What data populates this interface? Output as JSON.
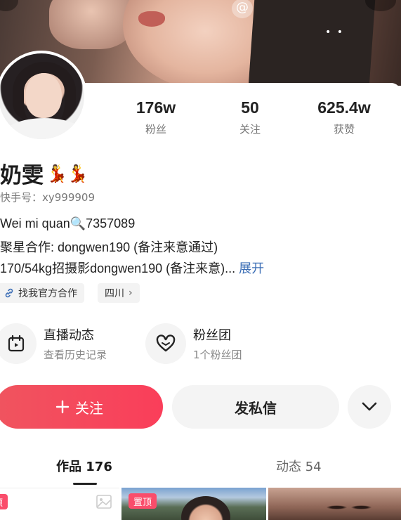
{
  "profile": {
    "name": "奶雯",
    "name_emoji": "💃💃",
    "kuaishou_id": "快手号：xy999909",
    "stats": [
      {
        "value": "176w",
        "label": "粉丝"
      },
      {
        "value": "50",
        "label": "关注"
      },
      {
        "value": "625.4w",
        "label": "获赞"
      }
    ],
    "bio_lines": [
      "Wei mi quan🔍7357089",
      "聚星合作: dongwen190 (备注来意通过)",
      "170/54kg招摄影dongwen190 (备注来意)..."
    ],
    "bio_more": "展开",
    "chips": {
      "official": "找我官方合作",
      "region": "四川"
    }
  },
  "features": [
    {
      "title": "直播动态",
      "subtitle": "查看历史记录",
      "icon": "calendar-icon"
    },
    {
      "title": "粉丝团",
      "subtitle": "1个粉丝团",
      "icon": "heart-outline-icon"
    }
  ],
  "actions": {
    "follow_label": "关注",
    "message_label": "发私信"
  },
  "tabs": [
    {
      "label": "作品 176"
    },
    {
      "label": "动态 54"
    }
  ],
  "thumbnails": {
    "pin_label": "置顶",
    "pin_label_partial": "顶"
  },
  "colors": {
    "accent": "#FA3E5A",
    "link": "#3D6FB6",
    "muted": "#777777"
  }
}
